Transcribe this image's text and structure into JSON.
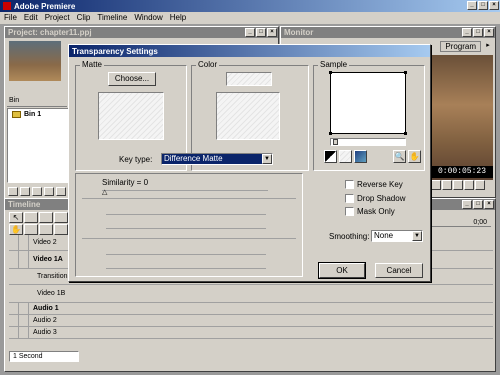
{
  "app": {
    "title": "Adobe Premiere"
  },
  "menu": [
    "File",
    "Edit",
    "Project",
    "Clip",
    "Timeline",
    "Window",
    "Help"
  ],
  "project": {
    "title": "Project: chapter11.ppj",
    "bin_header": "Bin",
    "bin_item": "Bin 1"
  },
  "monitor": {
    "title": "Monitor",
    "tab": "Program",
    "timecode": "0:00:05:23"
  },
  "dialog": {
    "title": "Transparency Settings",
    "matte_label": "Matte",
    "choose_label": "Choose...",
    "color_label": "Color",
    "sample_label": "Sample",
    "keytype_label": "Key type:",
    "keytype_value": "Difference Matte",
    "similarity_label": "Similarity = 0",
    "reverse_key": "Reverse Key",
    "drop_shadow": "Drop Shadow",
    "mask_only": "Mask Only",
    "smoothing_label": "Smoothing:",
    "smoothing_value": "None",
    "ok": "OK",
    "cancel": "Cancel"
  },
  "timeline": {
    "title": "Timeline",
    "ruler": "0;00",
    "tracks": [
      "Video 2",
      "Video 1A",
      "Transition",
      "Video 1B",
      "Audio 1",
      "Audio 2",
      "Audio 3"
    ],
    "scale": "1 Second"
  },
  "colors": {
    "titlebar": "#0a246a",
    "face": "#d4d0c8",
    "keytype_bg": "#0a246a"
  }
}
